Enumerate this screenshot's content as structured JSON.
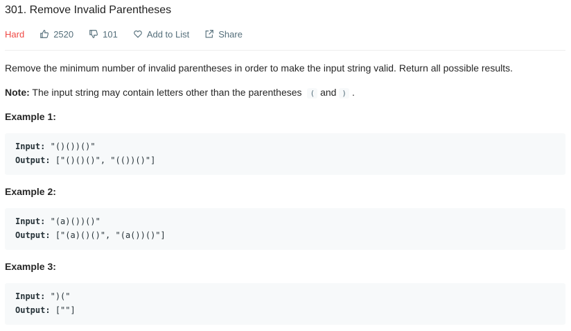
{
  "problem": {
    "title": "301. Remove Invalid Parentheses",
    "difficulty": "Hard",
    "likes": "2520",
    "dislikes": "101",
    "add_to_list": "Add to List",
    "share": "Share",
    "description": "Remove the minimum number of invalid parentheses in order to make the input string valid. Return all possible results.",
    "note_label": "Note:",
    "note_text": "The input string may contain letters other than the parentheses",
    "note_paren_open": "(",
    "note_and": "and",
    "note_paren_close": ")",
    "note_period": "."
  },
  "examples": [
    {
      "heading": "Example 1:",
      "input_label": "Input:",
      "input": "\"()())()\"",
      "output_label": "Output:",
      "output": "[\"()()()\", \"(())()\"]"
    },
    {
      "heading": "Example 2:",
      "input_label": "Input:",
      "input": "\"(a)())()\"",
      "output_label": "Output:",
      "output": "[\"(a)()()\", \"(a())()\"]"
    },
    {
      "heading": "Example 3:",
      "input_label": "Input:",
      "input": "\")(\"",
      "output_label": "Output:",
      "output": "[\"\"]"
    }
  ],
  "colors": {
    "difficulty_hard": "#ef4743",
    "meta_text": "#546e7a",
    "code_bg": "#f7f9fa"
  },
  "icons": {
    "like": "thumbs-up-icon",
    "dislike": "thumbs-down-icon",
    "add": "heart-icon",
    "share": "share-icon"
  }
}
